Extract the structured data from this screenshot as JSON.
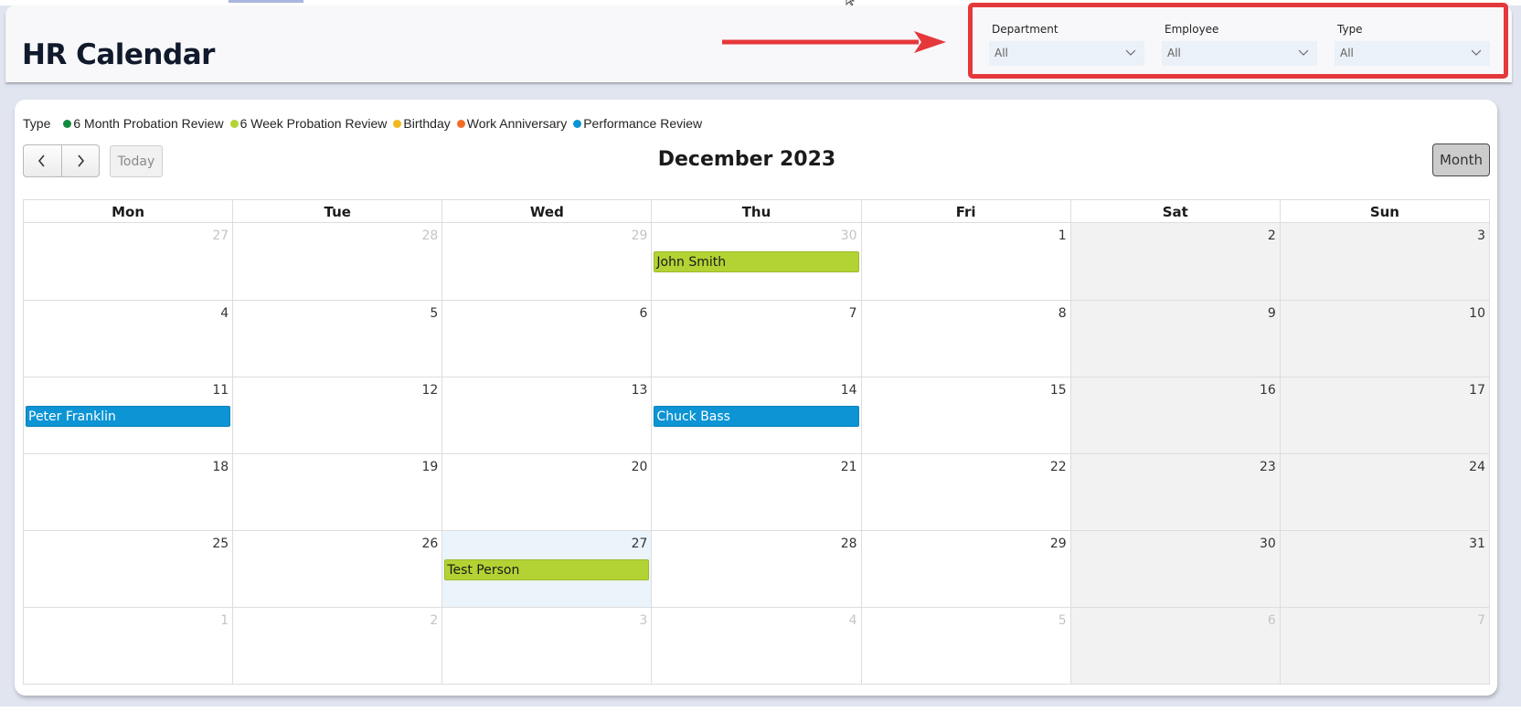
{
  "header": {
    "title": "HR Calendar"
  },
  "filters": [
    {
      "label": "Department",
      "value": "All"
    },
    {
      "label": "Employee",
      "value": "All"
    },
    {
      "label": "Type",
      "value": "All"
    }
  ],
  "annotation": {
    "arrow_color": "#e5383b",
    "highlight_color": "#e5383b"
  },
  "legend": {
    "title": "Type",
    "items": [
      {
        "label": "6 Month Probation Review",
        "color": "#118a3f"
      },
      {
        "label": "6 Week Probation Review",
        "color": "#b3d334"
      },
      {
        "label": "Birthday",
        "color": "#f2b81e"
      },
      {
        "label": "Work Anniversary",
        "color": "#f26c24"
      },
      {
        "label": "Performance Review",
        "color": "#0c94d4"
      }
    ]
  },
  "toolbar": {
    "prev_icon": "chevron-left-icon",
    "next_icon": "chevron-right-icon",
    "today_label": "Today",
    "month_label": "December 2023",
    "view_label": "Month"
  },
  "calendar": {
    "weekdays": [
      "Mon",
      "Tue",
      "Wed",
      "Thu",
      "Fri",
      "Sat",
      "Sun"
    ],
    "weeks": [
      [
        {
          "day": "27",
          "other": true
        },
        {
          "day": "28",
          "other": true
        },
        {
          "day": "29",
          "other": true
        },
        {
          "day": "30",
          "other": true,
          "event": {
            "name": "John Smith",
            "color": "#b3d334",
            "text_color": "#1b1b1b"
          }
        },
        {
          "day": "1"
        },
        {
          "day": "2",
          "weekend": true
        },
        {
          "day": "3",
          "weekend": true
        }
      ],
      [
        {
          "day": "4"
        },
        {
          "day": "5"
        },
        {
          "day": "6"
        },
        {
          "day": "7"
        },
        {
          "day": "8"
        },
        {
          "day": "9",
          "weekend": true
        },
        {
          "day": "10",
          "weekend": true
        }
      ],
      [
        {
          "day": "11",
          "event": {
            "name": "Peter Franklin",
            "color": "#0c94d4",
            "text_color": "#ffffff"
          }
        },
        {
          "day": "12"
        },
        {
          "day": "13"
        },
        {
          "day": "14",
          "event": {
            "name": "Chuck Bass",
            "color": "#0c94d4",
            "text_color": "#ffffff"
          }
        },
        {
          "day": "15"
        },
        {
          "day": "16",
          "weekend": true
        },
        {
          "day": "17",
          "weekend": true
        }
      ],
      [
        {
          "day": "18"
        },
        {
          "day": "19"
        },
        {
          "day": "20"
        },
        {
          "day": "21"
        },
        {
          "day": "22"
        },
        {
          "day": "23",
          "weekend": true
        },
        {
          "day": "24",
          "weekend": true
        }
      ],
      [
        {
          "day": "25"
        },
        {
          "day": "26"
        },
        {
          "day": "27",
          "today": true,
          "event": {
            "name": "Test Person",
            "color": "#b3d334",
            "text_color": "#1b1b1b"
          }
        },
        {
          "day": "28"
        },
        {
          "day": "29"
        },
        {
          "day": "30",
          "weekend": true
        },
        {
          "day": "31",
          "weekend": true
        }
      ],
      [
        {
          "day": "1",
          "other": true
        },
        {
          "day": "2",
          "other": true
        },
        {
          "day": "3",
          "other": true
        },
        {
          "day": "4",
          "other": true
        },
        {
          "day": "5",
          "other": true
        },
        {
          "day": "6",
          "other": true,
          "weekend": true
        },
        {
          "day": "7",
          "other": true,
          "weekend": true
        }
      ]
    ]
  }
}
